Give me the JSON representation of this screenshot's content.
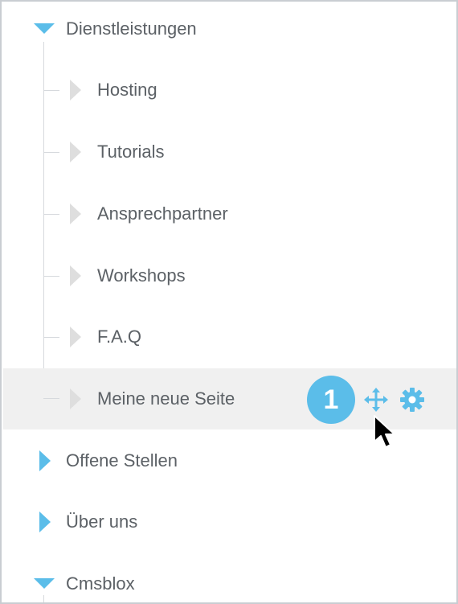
{
  "tree": {
    "root": {
      "label": "Dienstleistungen",
      "expanded": true
    },
    "children": [
      {
        "label": "Hosting"
      },
      {
        "label": "Tutorials"
      },
      {
        "label": "Ansprechpartner"
      },
      {
        "label": "Workshops"
      },
      {
        "label": "F.A.Q"
      },
      {
        "label": "Meine neue Seite"
      }
    ],
    "siblings": [
      {
        "label": "Offene Stellen",
        "expanded": false
      },
      {
        "label": "Über uns",
        "expanded": false
      },
      {
        "label": "Cmsblox",
        "expanded": true
      }
    ]
  },
  "actions": {
    "step_badge": "1",
    "move_icon": "move-arrows-icon",
    "settings_icon": "gear-icon"
  },
  "colors": {
    "accent": "#5bbde9",
    "text": "#5c6166",
    "highlight_row": "#f0f0f0",
    "collapsed_child_arrow": "#dedede"
  }
}
